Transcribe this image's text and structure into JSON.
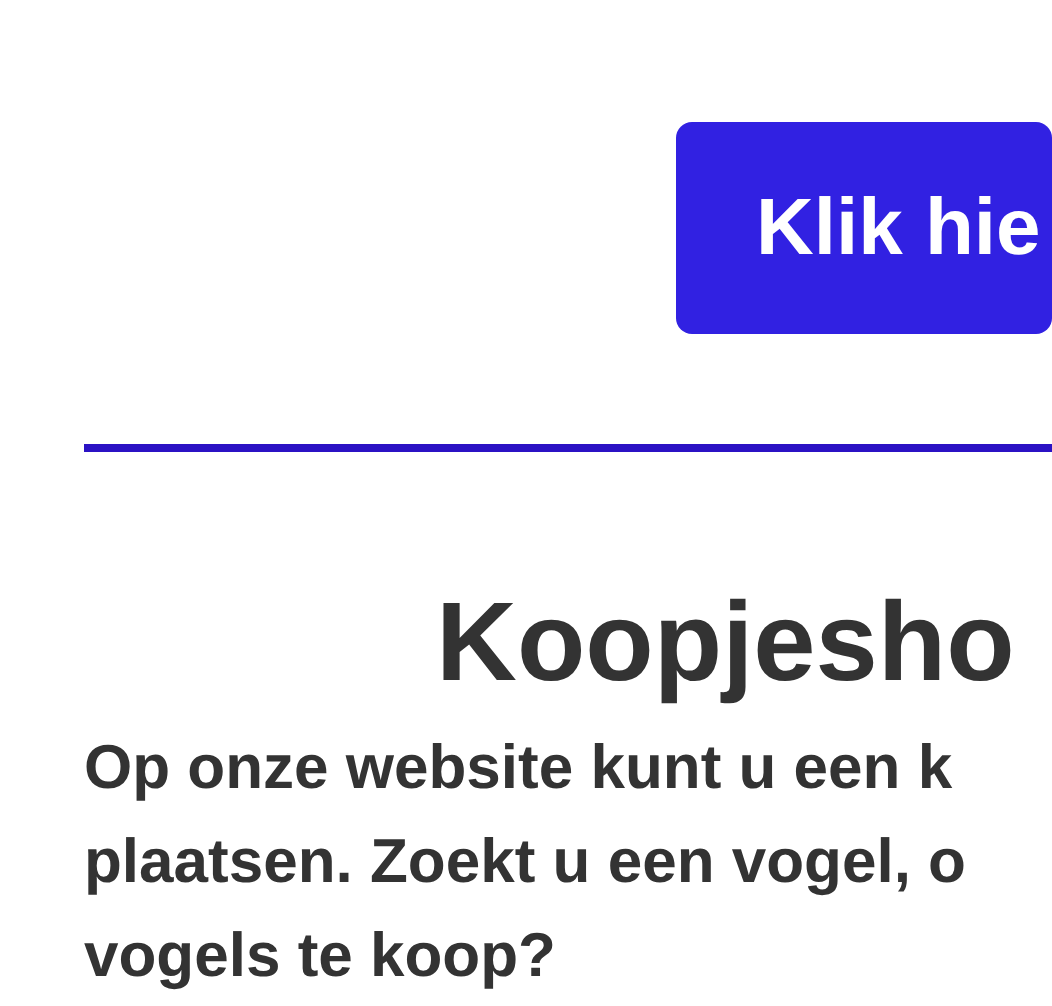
{
  "header": {
    "button": "Klik hie"
  },
  "heading": "Koopjesho",
  "intro": "Op onze website kunt u een k\nplaatsen. Zoekt u een vogel, o\nvogels te koop?"
}
